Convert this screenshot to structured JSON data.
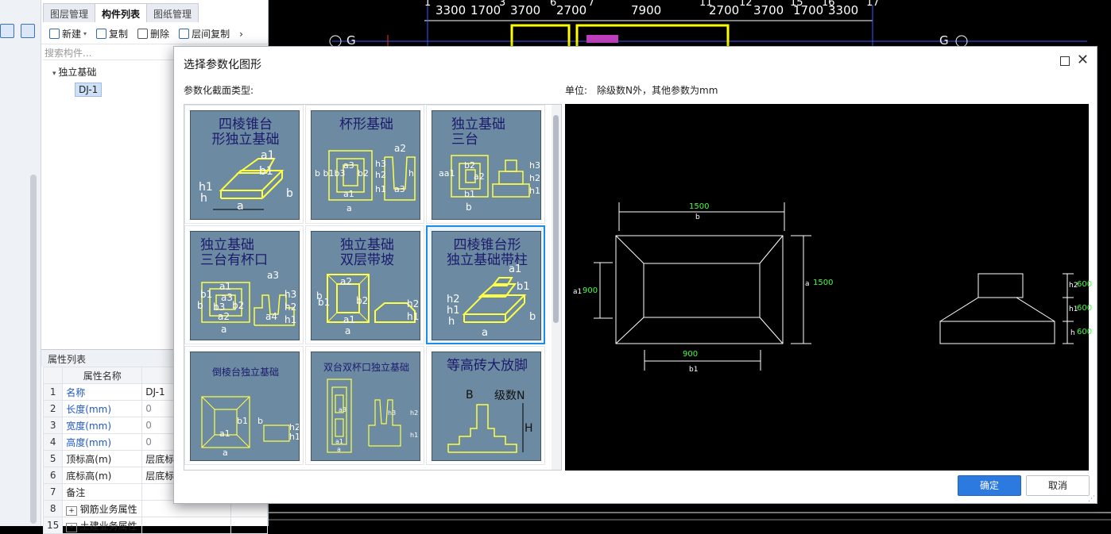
{
  "panel": {
    "tabs": [
      "图层管理",
      "构件列表",
      "图纸管理"
    ],
    "toolbar": {
      "new": "新建",
      "copy": "复制",
      "delete": "删除",
      "floor_copy": "层间复制"
    },
    "search_placeholder": "搜索构件...",
    "tree": {
      "group": "独立基础",
      "item": "DJ-1"
    },
    "props_title": "属性列表",
    "props_header": {
      "name": "属性名称"
    },
    "props": [
      {
        "no": "1",
        "name": "名称",
        "value": "DJ-1"
      },
      {
        "no": "2",
        "name": "长度(mm)",
        "value": "0"
      },
      {
        "no": "3",
        "name": "宽度(mm)",
        "value": "0"
      },
      {
        "no": "4",
        "name": "高度(mm)",
        "value": "0"
      },
      {
        "no": "5",
        "name": "顶标高(m)",
        "value": "层底标"
      },
      {
        "no": "6",
        "name": "底标高(m)",
        "value": "层底标"
      },
      {
        "no": "7",
        "name": "备注",
        "value": ""
      },
      {
        "no": "8",
        "name": "钢筋业务属性",
        "value": ""
      },
      {
        "no": "15",
        "name": "土建业务属性",
        "value": ""
      }
    ]
  },
  "cad": {
    "axis_dims": [
      "3300",
      "1700",
      "3700",
      "2700",
      "7900",
      "2700",
      "3700",
      "1700",
      "3300"
    ],
    "axis_nums": [
      "1",
      "3",
      "4",
      "6",
      "7",
      "11",
      "12",
      "15",
      "16",
      "17"
    ],
    "grid_labels": [
      "G",
      "G"
    ]
  },
  "dialog": {
    "title": "选择参数化图形",
    "type_label": "参数化截面类型:",
    "unit_label": "单位:　除级数N外，其他参数为mm",
    "ok": "确定",
    "cancel": "取消",
    "thumbnails": [
      {
        "title": "四棱锥台\n形独立基础",
        "labels": [
          "a1",
          "b1",
          "h1",
          "h",
          "a",
          "b"
        ]
      },
      {
        "title": "杯形基础",
        "labels": [
          "a2",
          "b b1b3",
          "a3",
          "b2",
          "h3",
          "h2",
          "h",
          "h1",
          "a1",
          "a3",
          "a"
        ]
      },
      {
        "title": "独立基础\n三台",
        "labels": [
          "aa1",
          "b2",
          "a2",
          "b1",
          "b",
          "h3",
          "h2",
          "h1"
        ]
      },
      {
        "title": "独立基础\n三台有杯口",
        "labels": [
          "a3",
          "a1",
          "b1",
          "a3",
          "b",
          "b3",
          "b2",
          "h3",
          "h2",
          "h1",
          "a2",
          "a4",
          "a"
        ]
      },
      {
        "title": "独立基础\n双层带坡",
        "labels": [
          "a2",
          "b",
          "b1",
          "b2",
          "h2",
          "h1",
          "a1",
          "a"
        ]
      },
      {
        "title": "四棱锥台形\n独立基础带柱",
        "labels": [
          "a1",
          "b1",
          "h2",
          "h1",
          "h",
          "a",
          "b"
        ]
      },
      {
        "title": "倒棱台独立基础",
        "labels": [
          "b1",
          "b",
          "h2",
          "h1",
          "a1",
          "a"
        ]
      },
      {
        "title": "双台双杯口独立基础",
        "labels": [
          "a3",
          "h3",
          "h2",
          "h1",
          "a1",
          "a"
        ]
      },
      {
        "title": "等高砖大放脚",
        "labels": [
          "B",
          "级数N",
          "H"
        ]
      }
    ],
    "preview": {
      "top_dim": "1500",
      "top_name": "b",
      "left_dim": "900",
      "left_name": "a1",
      "right_dim": "1500",
      "right_name": "a",
      "bottom_dim": "900",
      "bottom_name": "b1",
      "h2_name": "h2",
      "h2": "600",
      "h1_name": "h1",
      "h1": "600",
      "h_name": "h",
      "h": "600"
    }
  },
  "colors": {
    "accent": "#2c79e0",
    "cad_green": "#44ff44",
    "thumb_bg": "#6c8aa1"
  }
}
